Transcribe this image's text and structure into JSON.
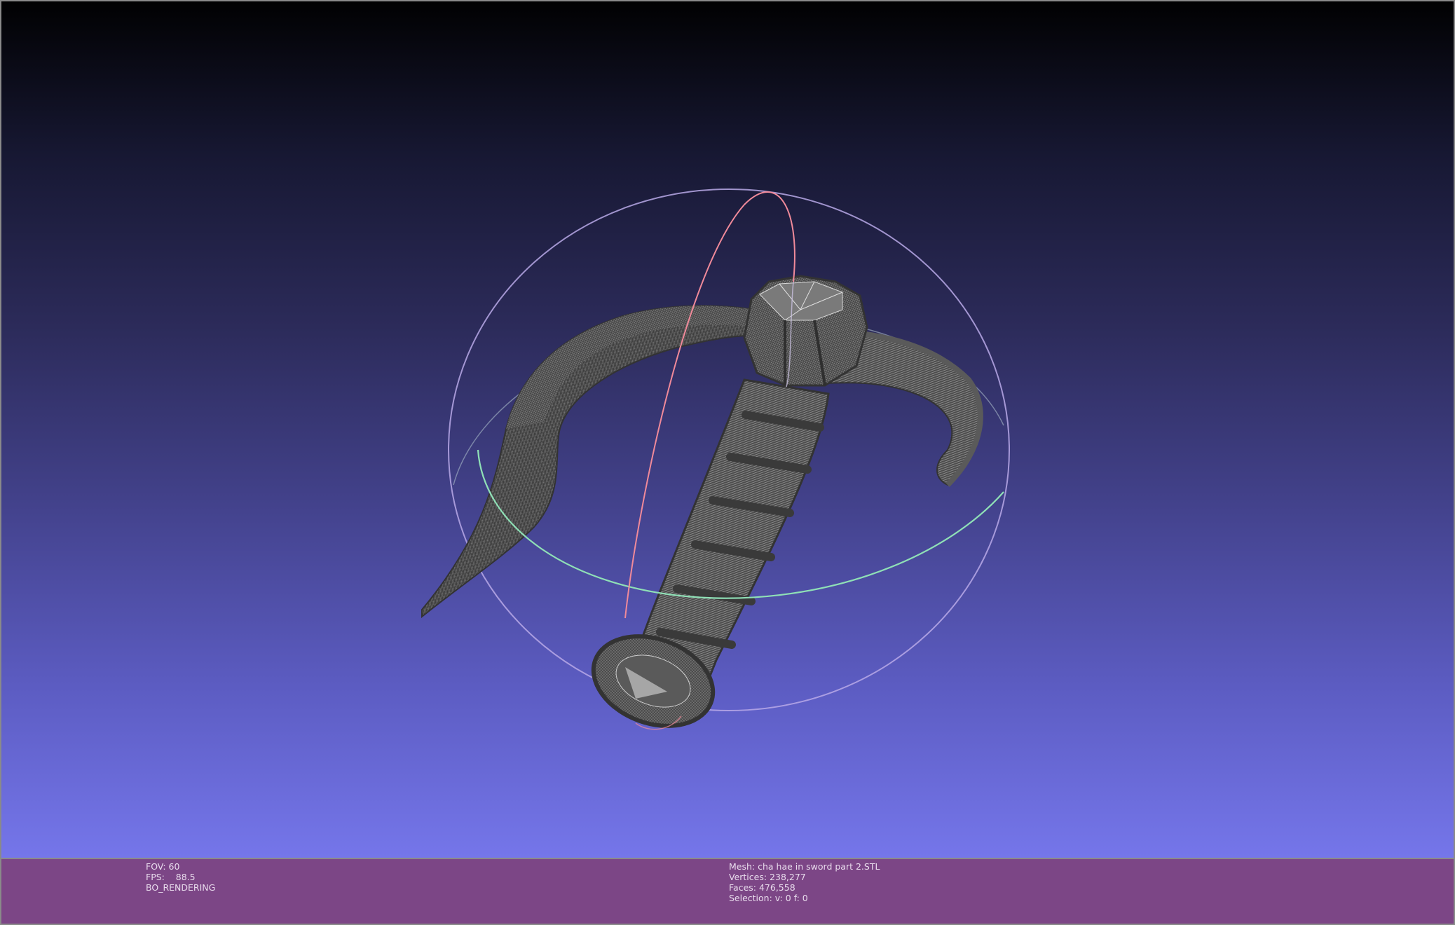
{
  "viewer": {
    "background_top": "#010102",
    "background_bottom": "#7576ea",
    "info_bar_color": "#7c4686",
    "mesh_color": "#4a4a4a",
    "trackball_colors": {
      "horizontal_ring": "#8fe0b6",
      "vertical_ring": "#f08a9a",
      "outer_ring": "#b8a9e8"
    }
  },
  "info_left": {
    "fov": "FOV: 60",
    "fps": "FPS:    88.5",
    "render_mode": "BO_RENDERING"
  },
  "info_right": {
    "mesh": "Mesh: cha hae in sword part 2.STL",
    "vertices": "Vertices: 238,277",
    "faces": "Faces: 476,558",
    "selection": "Selection: v: 0 f: 0"
  }
}
